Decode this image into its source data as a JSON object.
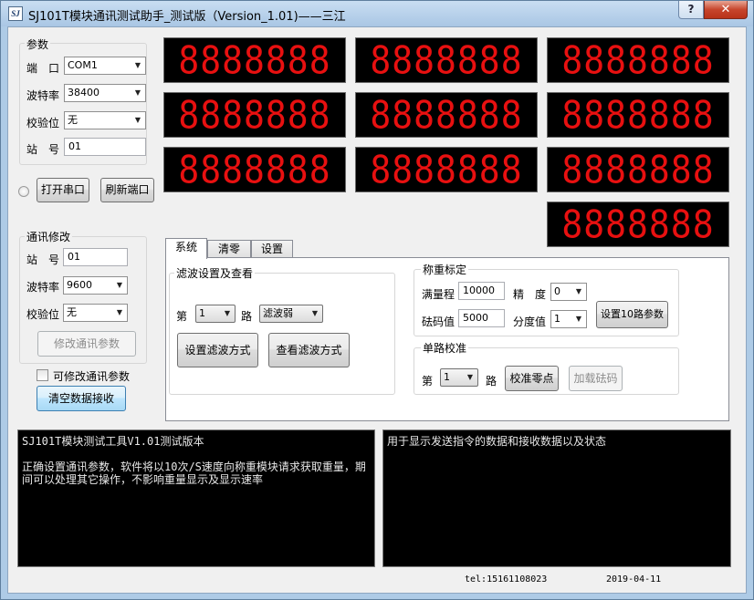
{
  "window": {
    "title": "SJ101T模块通讯测试助手_测试版（Version_1.01)——三江",
    "icon_text": "SJ",
    "help_label": "?",
    "close_label": "✕"
  },
  "params": {
    "group_label": "参数",
    "port_label": "端　口",
    "port_value": "COM1",
    "baud_label": "波特率",
    "baud_value": "38400",
    "parity_label": "校验位",
    "parity_value": "无",
    "station_label": "站　号",
    "station_value": "01",
    "open_port_label": "打开串口",
    "refresh_port_label": "刷新端口"
  },
  "comm_edit": {
    "group_label": "通讯修改",
    "station_label": "站　号",
    "station_value": "01",
    "baud_label": "波特率",
    "baud_value": "9600",
    "parity_label": "校验位",
    "parity_value": "无",
    "modify_label": "修改通讯参数",
    "allow_modify_label": "可修改通讯参数",
    "clear_label": "清空数据接收"
  },
  "displays": [
    "8888888",
    "8888888",
    "8888888",
    "8888888",
    "8888888",
    "8888888",
    "8888888",
    "8888888",
    "8888888",
    "8888888"
  ],
  "tabs": [
    "系统",
    "清零",
    "设置"
  ],
  "filter": {
    "group_label": "滤波设置及查看",
    "prefix": "第",
    "channel_value": "1",
    "suffix": "路",
    "mode_value": "滤波弱",
    "set_label": "设置滤波方式",
    "view_label": "查看滤波方式"
  },
  "calib": {
    "group_label": "称重标定",
    "range_label": "满量程",
    "range_value": "10000",
    "precision_label": "精　度",
    "precision_value": "0",
    "weight_label": "砝码值",
    "weight_value": "5000",
    "division_label": "分度值",
    "division_value": "1",
    "set10_label": "设置10路参数"
  },
  "single": {
    "group_label": "单路校准",
    "prefix": "第",
    "channel_value": "1",
    "suffix": "路",
    "zero_label": "校准零点",
    "load_label": "加载砝码"
  },
  "console_left": "SJ101T模块测试工具V1.01测试版本\n\n正确设置通讯参数，软件将以10次/S速度向称重模块请求获取重量，期间可以处理其它操作，不影响重量显示及显示速率",
  "console_right": "用于显示发送指令的数据和接收数据以及状态",
  "status": {
    "tel": "tel:15161108023",
    "date": "2019-04-11"
  }
}
